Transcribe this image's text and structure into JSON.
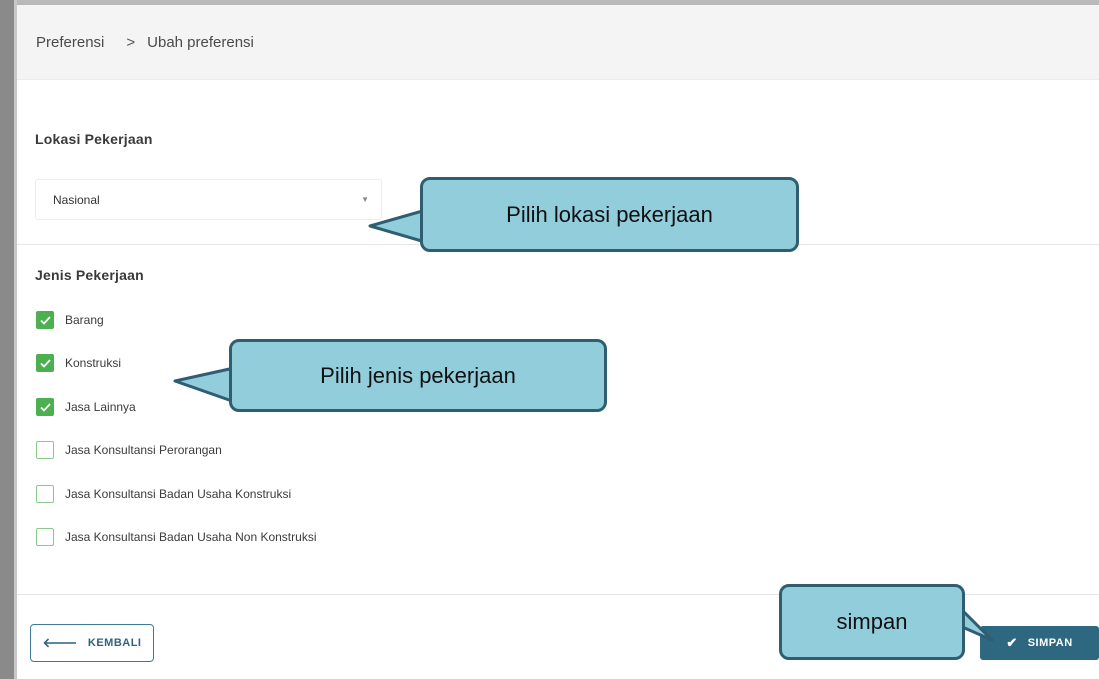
{
  "breadcrumb": {
    "parent": "Preferensi",
    "separator": ">",
    "current": "Ubah preferensi"
  },
  "lokasi": {
    "label": "Lokasi Pekerjaan",
    "selected": "Nasional",
    "caret": "▼"
  },
  "jenis": {
    "label": "Jenis Pekerjaan",
    "options": [
      {
        "label": "Barang",
        "checked": true
      },
      {
        "label": "Konstruksi",
        "checked": true
      },
      {
        "label": "Jasa Lainnya",
        "checked": true
      },
      {
        "label": "Jasa Konsultansi Perorangan",
        "checked": false
      },
      {
        "label": "Jasa Konsultansi Badan Usaha Konstruksi",
        "checked": false
      },
      {
        "label": "Jasa Konsultansi Badan Usaha Non Konstruksi",
        "checked": false
      }
    ]
  },
  "actions": {
    "back_label": "KEMBALI",
    "back_icon": "arrow-left-icon",
    "save_label": "SIMPAN",
    "save_icon": "check-icon"
  },
  "callouts": {
    "lokasi": "Pilih lokasi pekerjaan",
    "jenis": "Pilih jenis pekerjaan",
    "simpan": "simpan"
  },
  "colors": {
    "primary": "#2e6880",
    "checkbox": "#4caf50",
    "callout_fill": "#92cddc",
    "callout_border": "#2f5e73"
  }
}
